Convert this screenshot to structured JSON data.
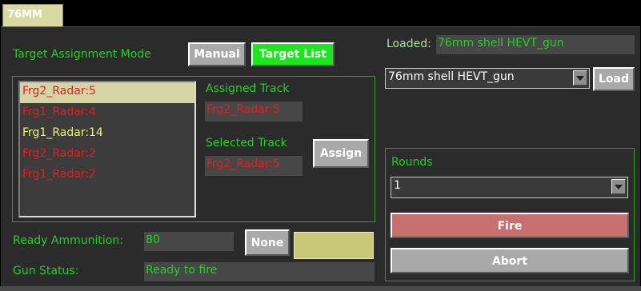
{
  "tab": {
    "label": "76MM"
  },
  "target_assignment": {
    "mode_label": "Target Assignment Mode",
    "manual_label": "Manual",
    "target_list_label": "Target List"
  },
  "tracks": {
    "items": [
      {
        "label": "Frg2_Radar:5"
      },
      {
        "label": "Frg1_Radar:4"
      },
      {
        "label": "Frg1_Radar:14"
      },
      {
        "label": "Frg2_Radar:2"
      },
      {
        "label": "Frg1_Radar:2"
      }
    ],
    "assigned_label": "Assigned Track",
    "assigned_value": "Frg2_Radar:5",
    "selected_label": "Selected Track",
    "selected_value": "Frg2_Radar:5",
    "assign_label": "Assign"
  },
  "loaded": {
    "label": "Loaded:",
    "value": "76mm shell HEVT_gun",
    "combo_value": "76mm shell HEVT_gun",
    "load_label": "Load"
  },
  "rounds": {
    "label": "Rounds",
    "value": "1",
    "fire_label": "Fire",
    "abort_label": "Abort"
  },
  "ammo": {
    "label": "Ready Ammunition:",
    "value": "80",
    "none_label": "None"
  },
  "status": {
    "label": "Gun Status:",
    "value": "Ready to fire"
  },
  "colors": {
    "accent_green": "#22d022",
    "track_red": "#e02020",
    "track_yellow": "#f2f26a",
    "fire_button": "#c87070",
    "tab_bg": "#d9d9a6"
  }
}
